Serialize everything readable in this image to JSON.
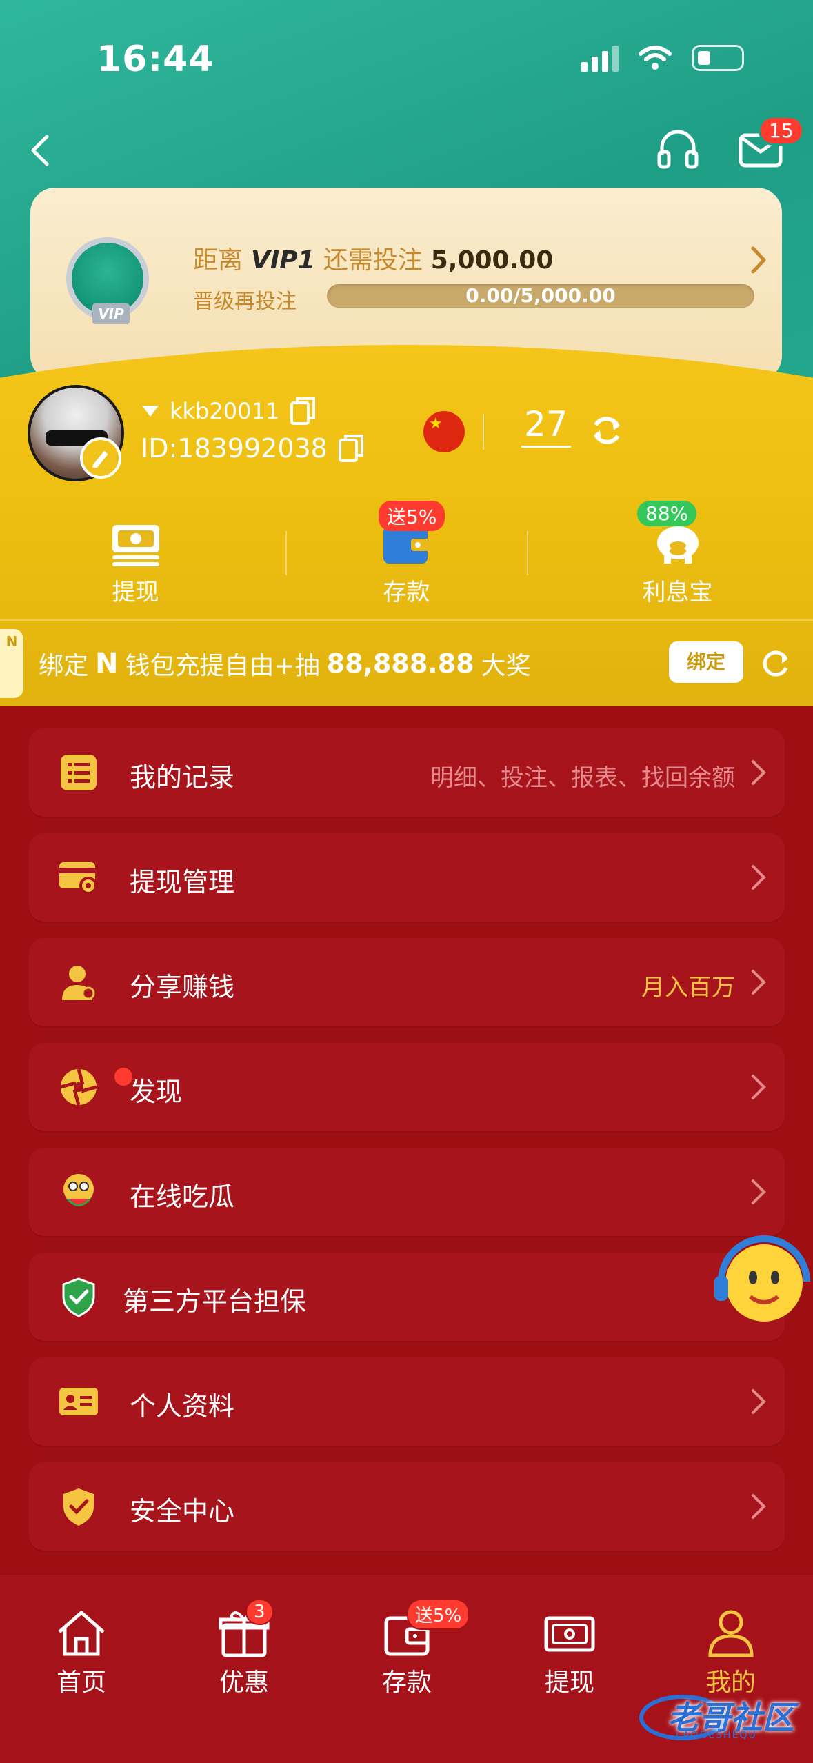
{
  "status_bar": {
    "time": "16:44"
  },
  "header": {
    "mail_badge": "15"
  },
  "vip": {
    "prefix": "距离",
    "level": "VIP1",
    "middle": "还需投注",
    "amount": "5,000.00",
    "upgrade_label": "晋级再投注",
    "progress_text": "0.00/5,000.00",
    "progress_fraction": 0.0,
    "badge_label": "VIP"
  },
  "user": {
    "username": "kkb20011",
    "id_text": "ID:183992038",
    "balance": "27"
  },
  "quick_actions": [
    {
      "label": "提现"
    },
    {
      "label": "存款",
      "badge": "送5%"
    },
    {
      "label": "利息宝",
      "badge": "88%"
    }
  ],
  "promo": {
    "side_text": "N",
    "bind_text": "绑定",
    "brand": "N",
    "rest": "钱包充提自由+抽",
    "prize": "88,888.88",
    "suffix": "大奖",
    "button": "绑定"
  },
  "menu": [
    {
      "label": "我的记录",
      "hint": "明细、投注、报表、找回余额",
      "icon": "list-icon"
    },
    {
      "label": "提现管理",
      "hint": "",
      "icon": "card-settings-icon"
    },
    {
      "label": "分享赚钱",
      "hint": "月入百万",
      "icon": "user-share-icon"
    },
    {
      "label": "发现",
      "hint": "",
      "icon": "aperture-icon"
    },
    {
      "label": "在线吃瓜",
      "hint": "",
      "icon": "melon-face-icon"
    },
    {
      "label": "第三方平台担保",
      "hint": "",
      "icon": "shield-check-icon"
    },
    {
      "label": "个人资料",
      "hint": "",
      "icon": "id-card-icon"
    },
    {
      "label": "安全中心",
      "hint": "",
      "icon": "shield-icon"
    }
  ],
  "tabs": [
    {
      "label": "首页"
    },
    {
      "label": "优惠",
      "badge": "3"
    },
    {
      "label": "存款",
      "badge": "送5%"
    },
    {
      "label": "提现"
    },
    {
      "label": "我的"
    }
  ],
  "watermark": {
    "text": "老哥社区",
    "sub": "LAOGESHEQU"
  },
  "colors": {
    "header_teal": "#1f9e86",
    "panel_yellow": "#f0c21a",
    "background_red": "#9e0f14",
    "menu_red": "#a8141b",
    "accent_gold": "#f5c542",
    "badge_red": "#ff3b30",
    "badge_green": "#34c759"
  }
}
